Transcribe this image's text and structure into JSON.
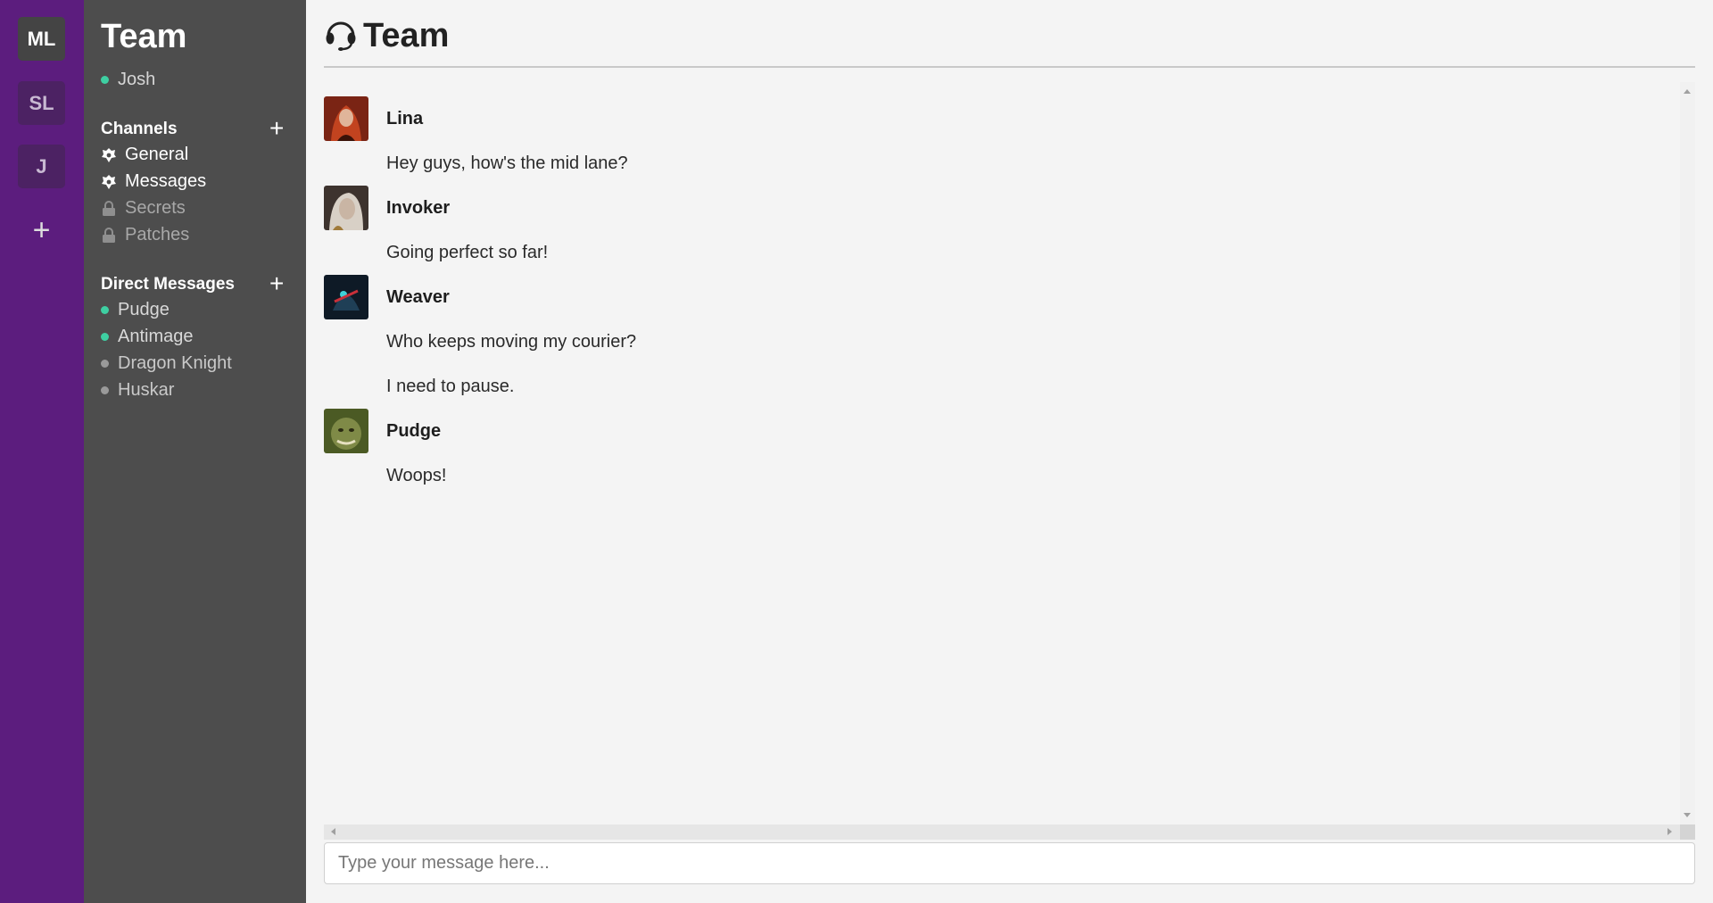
{
  "teams": [
    {
      "initials": "ML",
      "active": true
    },
    {
      "initials": "SL",
      "active": false
    },
    {
      "initials": "J",
      "active": false
    }
  ],
  "sidebar": {
    "team_name": "Team",
    "user": "Josh",
    "channels_heading": "Channels",
    "channels": [
      {
        "label": "General",
        "private": false
      },
      {
        "label": "Messages",
        "private": false
      },
      {
        "label": "Secrets",
        "private": true
      },
      {
        "label": "Patches",
        "private": true
      }
    ],
    "dm_heading": "Direct Messages",
    "direct_messages": [
      {
        "label": "Pudge",
        "online": true
      },
      {
        "label": "Antimage",
        "online": true
      },
      {
        "label": "Dragon Knight",
        "online": false
      },
      {
        "label": "Huskar",
        "online": false
      }
    ]
  },
  "header": {
    "title": "Team",
    "icon": "headset-icon"
  },
  "messages": [
    {
      "author": "Lina",
      "lines": [
        "Hey guys, how's the mid lane?"
      ],
      "avatar_color": "#a2351f"
    },
    {
      "author": "Invoker",
      "lines": [
        "Going perfect so far!"
      ],
      "avatar_color": "#b9aea6"
    },
    {
      "author": "Weaver",
      "lines": [
        "Who keeps moving my courier?",
        "I need to pause."
      ],
      "avatar_color": "#1b2e3f"
    },
    {
      "author": "Pudge",
      "lines": [
        "Woops!"
      ],
      "avatar_color": "#6e7c3a"
    }
  ],
  "composer": {
    "placeholder": "Type your message here..."
  },
  "colors": {
    "rail": "#5c1d7e",
    "sidebar": "#4d4d4d",
    "online": "#3ecfa2",
    "offline": "#9a9a9a"
  }
}
